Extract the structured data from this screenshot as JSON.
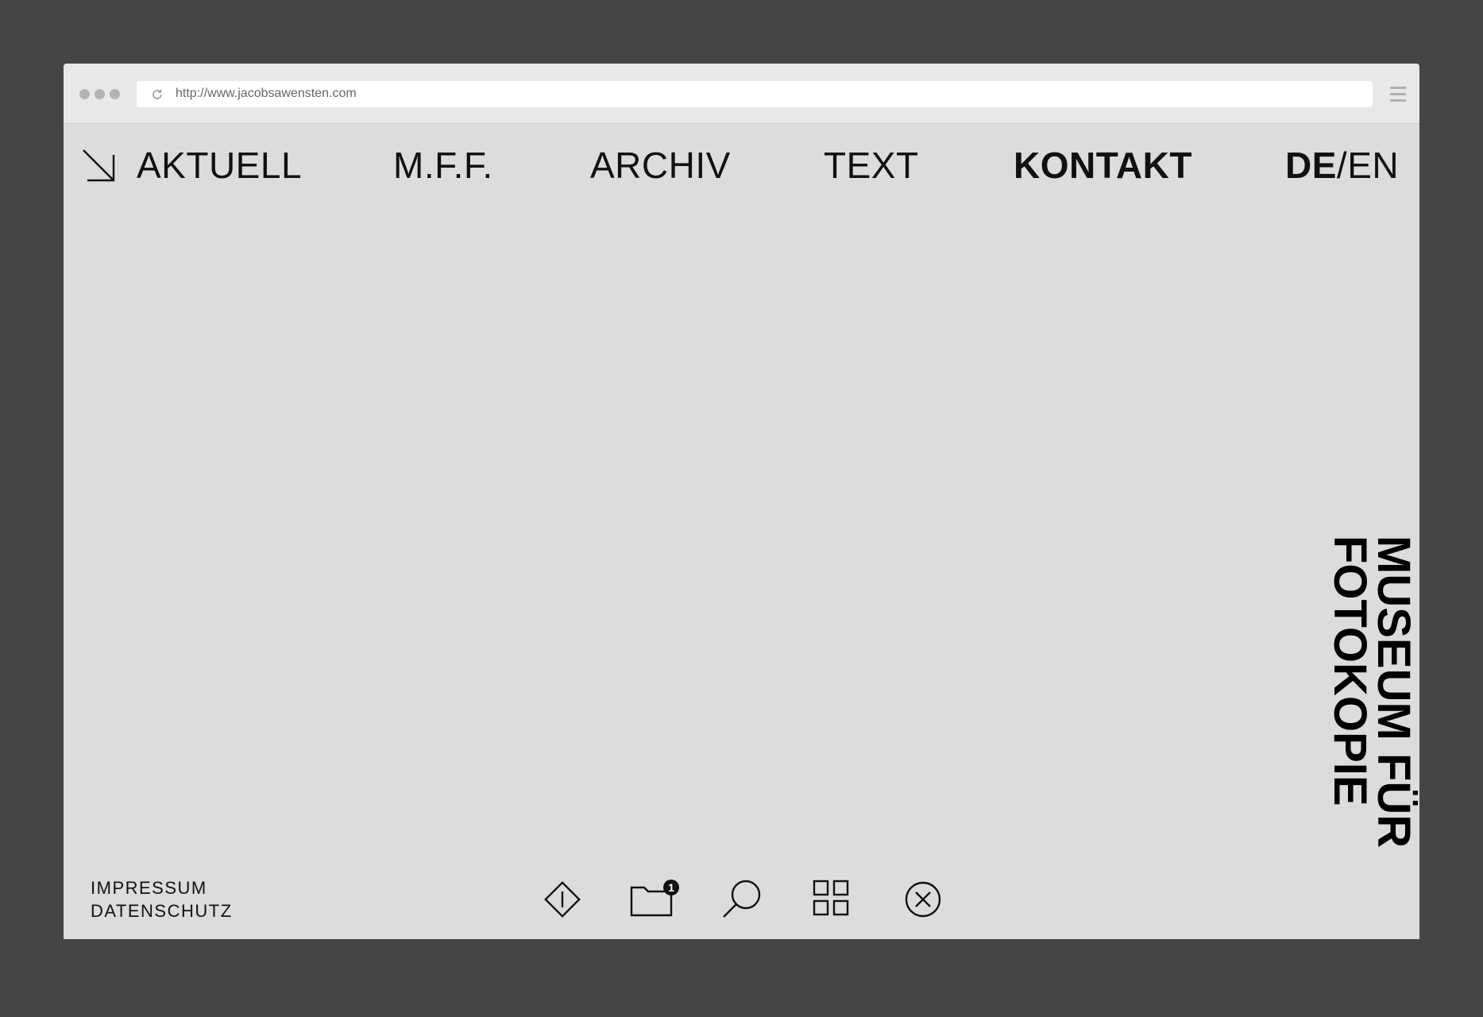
{
  "browser": {
    "url": "http://www.jacobsawensten.com"
  },
  "nav": {
    "items": [
      {
        "label": "AKTUELL"
      },
      {
        "label": "M.F.F."
      },
      {
        "label": "ARCHIV"
      },
      {
        "label": "TEXT"
      },
      {
        "label": "KONTAKT",
        "active": true
      }
    ],
    "lang_de": "DE",
    "lang_sep": "/",
    "lang_en": "EN"
  },
  "footer": {
    "impressum": "IMPRESSUM",
    "datenschutz": "DATENSCHUTZ"
  },
  "toolbar": {
    "icons": [
      "info-diamond-icon",
      "folder-icon",
      "search-icon",
      "grid-icon",
      "close-circle-icon"
    ],
    "folder_badge_count": "1"
  },
  "logo": {
    "line1": "MUSEUM FÜR",
    "line2": "FOTOKOPIE"
  }
}
